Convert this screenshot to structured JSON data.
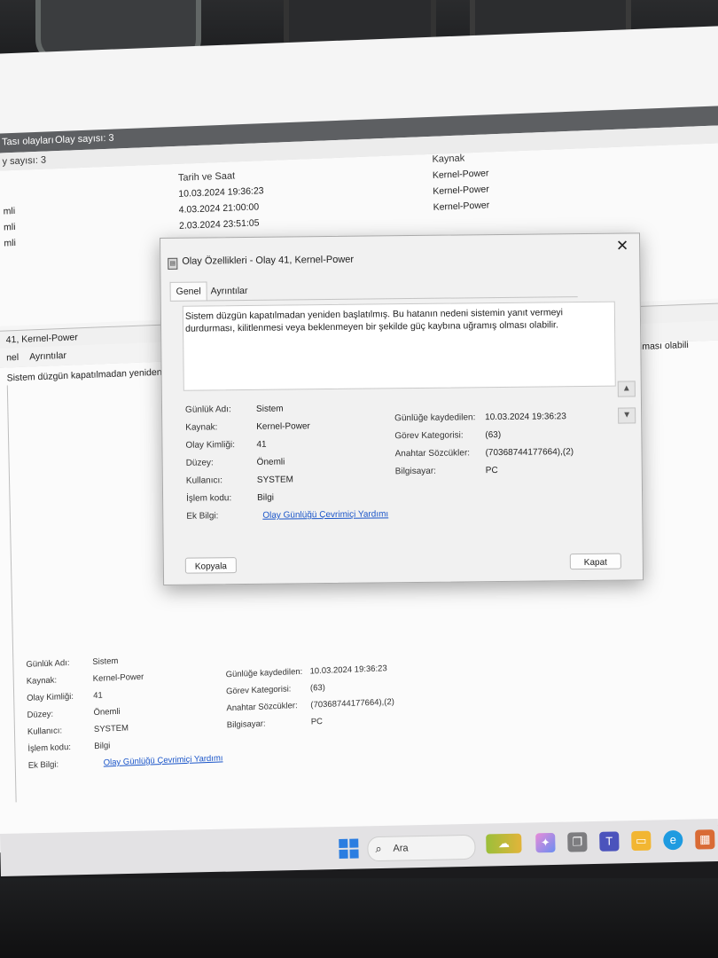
{
  "background": {
    "upper_header": "Tası olayları",
    "upper_count": "Olay sayısı: 3",
    "filter_count": "y sayısı: 3",
    "list_columns": {
      "date": "Tarih ve Saat",
      "source": "Kaynak"
    },
    "list_rows": [
      {
        "level": "mli",
        "date": "10.03.2024 19:36:23",
        "source": "Kernel-Power"
      },
      {
        "level": "mli",
        "date": "4.03.2024 21:00:00",
        "source": "Kernel-Power"
      },
      {
        "level": "mli",
        "date": "2.03.2024 23:51:05",
        "source": "Kernel-Power"
      }
    ],
    "detail_title": "41, Kernel-Power",
    "detail_tabs": [
      "nel",
      "Ayrıntılar"
    ],
    "detail_message": "Sistem düzgün kapatılmadan yeniden başlatı",
    "detail_message_right": "ramış olması olabili",
    "fields_left": [
      {
        "label": "Günlük Adı:",
        "value": "Sistem"
      },
      {
        "label": "Kaynak:",
        "value": "Kernel-Power"
      },
      {
        "label": "Olay Kimliği:",
        "value": "41"
      },
      {
        "label": "Düzey:",
        "value": "Önemli"
      },
      {
        "label": "Kullanıcı:",
        "value": "SYSTEM"
      },
      {
        "label": "İşlem kodu:",
        "value": "Bilgi"
      },
      {
        "label": "Ek Bilgi:",
        "value": "Olay Günlüğü Çevrimiçi Yardımı"
      }
    ],
    "fields_right": [
      {
        "label": "Günlüğe kaydedilen:",
        "value": "10.03.2024 19:36:23"
      },
      {
        "label": "Görev Kategorisi:",
        "value": "(63)"
      },
      {
        "label": "Anahtar Sözcükler:",
        "value": "(70368744177664),(2)"
      },
      {
        "label": "Bilgisayar:",
        "value": "PC"
      }
    ]
  },
  "dialog": {
    "title": "Olay Özellikleri - Olay 41, Kernel-Power",
    "close_glyph": "✕",
    "tabs": [
      "Genel",
      "Ayrıntılar"
    ],
    "message": "Sistem düzgün kapatılmadan yeniden başlatılmış. Bu hatanın nedeni sistemin yanıt vermeyi durdurması, kilitlenmesi veya beklenmeyen bir şekilde güç kaybına uğramış olması olabilir.",
    "fields_left": [
      {
        "label": "Günlük Adı:",
        "value": "Sistem"
      },
      {
        "label": "Kaynak:",
        "value": "Kernel-Power"
      },
      {
        "label": "Olay Kimliği:",
        "value": "41"
      },
      {
        "label": "Düzey:",
        "value": "Önemli"
      },
      {
        "label": "Kullanıcı:",
        "value": "SYSTEM"
      },
      {
        "label": "İşlem kodu:",
        "value": "Bilgi"
      },
      {
        "label": "Ek Bilgi:",
        "value": "Olay Günlüğü Çevrimiçi Yardımı"
      }
    ],
    "fields_right": [
      {
        "label": "Günlüğe kaydedilen:",
        "value": "10.03.2024 19:36:23"
      },
      {
        "label": "Görev Kategorisi:",
        "value": "(63)"
      },
      {
        "label": "Anahtar Sözcükler:",
        "value": "(70368744177664),(2)"
      },
      {
        "label": "Bilgisayar:",
        "value": "PC"
      }
    ],
    "copy_label": "Kopyala",
    "close_label": "Kapat"
  },
  "taskbar": {
    "search_placeholder": "Ara",
    "icons": [
      "windows-start-icon",
      "search-icon",
      "weather-widget-icon",
      "copilot-icon",
      "task-view-icon",
      "teams-icon",
      "file-explorer-icon",
      "edge-icon",
      "store-icon"
    ],
    "colors": {
      "start": "#2a7de1",
      "edge": "#1f9be0",
      "explorer": "#f2b632",
      "teams": "#4b53bc"
    }
  }
}
